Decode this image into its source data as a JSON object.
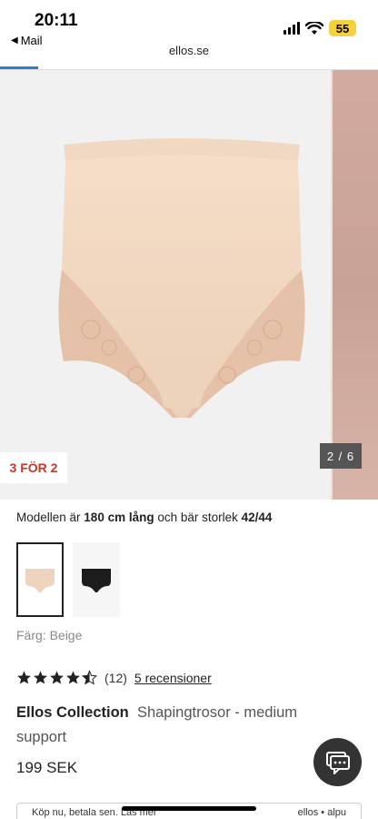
{
  "status_bar": {
    "time": "20:11",
    "back_label": "Mail",
    "battery": "55"
  },
  "browser": {
    "url": "ellos.se",
    "load_progress": 0.1
  },
  "gallery": {
    "badge": "3 FÖR 2",
    "counter": "2 / 6",
    "image_color": "#f0d6bf"
  },
  "product": {
    "model_info_prefix": "Modellen är ",
    "model_height": "180 cm lång",
    "model_info_mid": " och bär storlek ",
    "model_size": "42/44",
    "color_label": "Färg: Beige",
    "swatches": [
      {
        "name": "Beige",
        "color": "#efd4bd",
        "selected": true
      },
      {
        "name": "Black",
        "color": "#1d1d1d",
        "selected": false
      }
    ],
    "rating": 4.5,
    "rating_count": "(12)",
    "reviews_link": "5 recensioner",
    "brand": "Ellos Collection",
    "title": "Shapingtrosor - medium support",
    "price": "199 SEK"
  },
  "klarna": {
    "text": "Köp nu, betala sen. Läs mer",
    "logo_text": "ellos • alpu"
  },
  "colors": {
    "badge_red": "#c0392b",
    "accent_blue": "#2d7dc9"
  }
}
